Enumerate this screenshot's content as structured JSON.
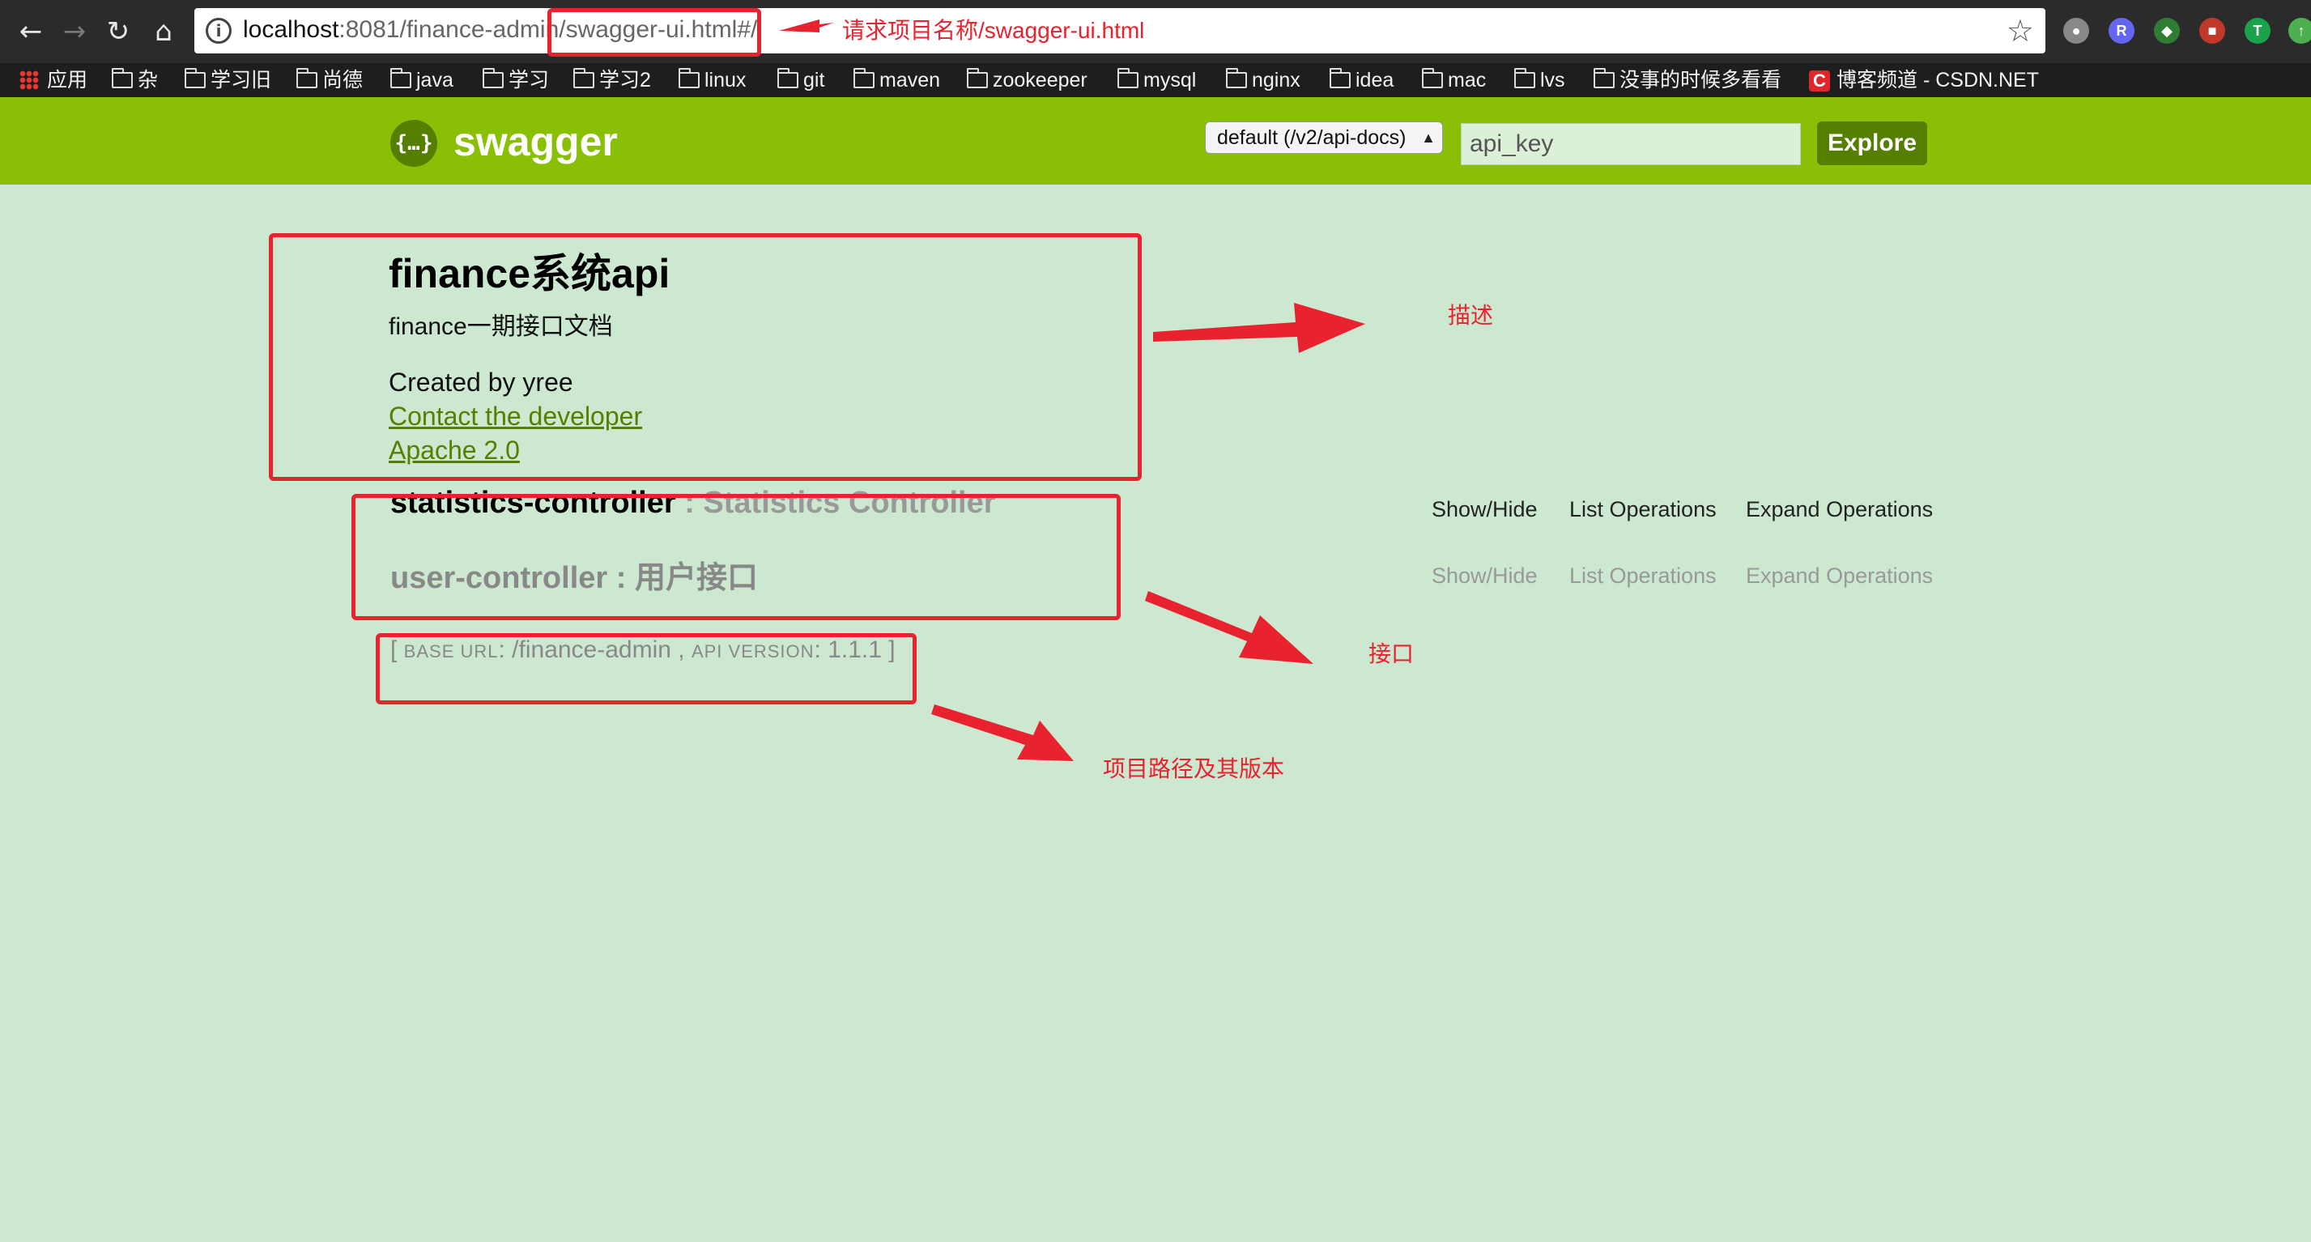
{
  "browser": {
    "url_host": "localhost",
    "url_rest": ":8081/finance-admin",
    "url_path": "/swagger-ui.html#/",
    "bookmarks": [
      "应用",
      "杂",
      "学习旧",
      "尚德",
      "java",
      "学习",
      "学习2",
      "linux",
      "git",
      "maven",
      "zookeeper",
      "mysql",
      "nginx",
      "idea",
      "mac",
      "lvs",
      "没事的时候多看看",
      "博客频道 - CSDN.NET"
    ]
  },
  "swagger": {
    "title": "swagger",
    "spec_select": "default (/v2/api-docs)",
    "api_key_placeholder": "api_key",
    "explore_label": "Explore"
  },
  "info": {
    "title": "finance系统api",
    "description": "finance一期接口文档",
    "created_by": "Created by yree",
    "contact_link": "Contact the developer",
    "license_link": "Apache 2.0"
  },
  "controllers": [
    {
      "name": "statistics-controller",
      "desc": " : Statistics Controller",
      "show_hide": "Show/Hide",
      "list_ops": "List Operations",
      "expand_ops": "Expand Operations"
    },
    {
      "name": "user-controller",
      "desc": " : 用户接口",
      "show_hide": "Show/Hide",
      "list_ops": "List Operations",
      "expand_ops": "Expand Operations"
    }
  ],
  "base": {
    "open": "[ ",
    "base_url_label": "BASE URL",
    "base_url_value": ": /finance-admin , ",
    "api_version_label": "API VERSION",
    "api_version_value": ": 1.1.1 ]"
  },
  "annotations": {
    "url_note": "请求项目名称/swagger-ui.html",
    "desc_note": "描述",
    "iface_note": "接口",
    "path_note": "项目路径及其版本"
  },
  "colors": {
    "header_green": "#89bf04",
    "dark_green": "#547f00",
    "annotation_red": "#e8222e",
    "page_background": "#cde8d0"
  },
  "icons": [
    "back-icon",
    "forward-icon",
    "reload-icon",
    "home-icon",
    "info-icon",
    "star-icon",
    "folder-icon",
    "apps-icon",
    "csdn-icon",
    "swagger-logo-icon"
  ]
}
